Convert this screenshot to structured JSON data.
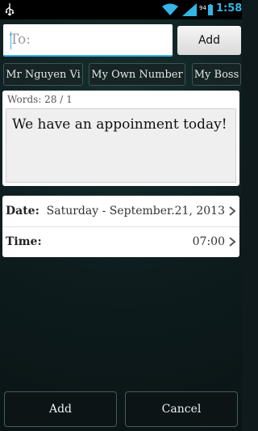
{
  "status_bar": {
    "time": "1:58",
    "battery_level": "94",
    "icons": [
      "usb-icon",
      "wifi-icon",
      "signal-icon",
      "battery-icon"
    ]
  },
  "compose": {
    "to_placeholder": "To:",
    "to_value": "",
    "add_button_label": "Add"
  },
  "contacts": [
    {
      "label": "Mr Nguyen Vi"
    },
    {
      "label": "My Own Number"
    },
    {
      "label": "My Boss"
    }
  ],
  "message": {
    "word_count": "Words: 28 / 1",
    "text": "We have an appoinment today!"
  },
  "schedule": {
    "date_label": "Date:",
    "date_value": "Saturday - September.21, 2013",
    "time_label": "Time:",
    "time_value": "07:00"
  },
  "actions": {
    "add_label": "Add",
    "cancel_label": "Cancel"
  },
  "colors": {
    "accent": "#33b5e5",
    "background": "#0f1a1c"
  }
}
